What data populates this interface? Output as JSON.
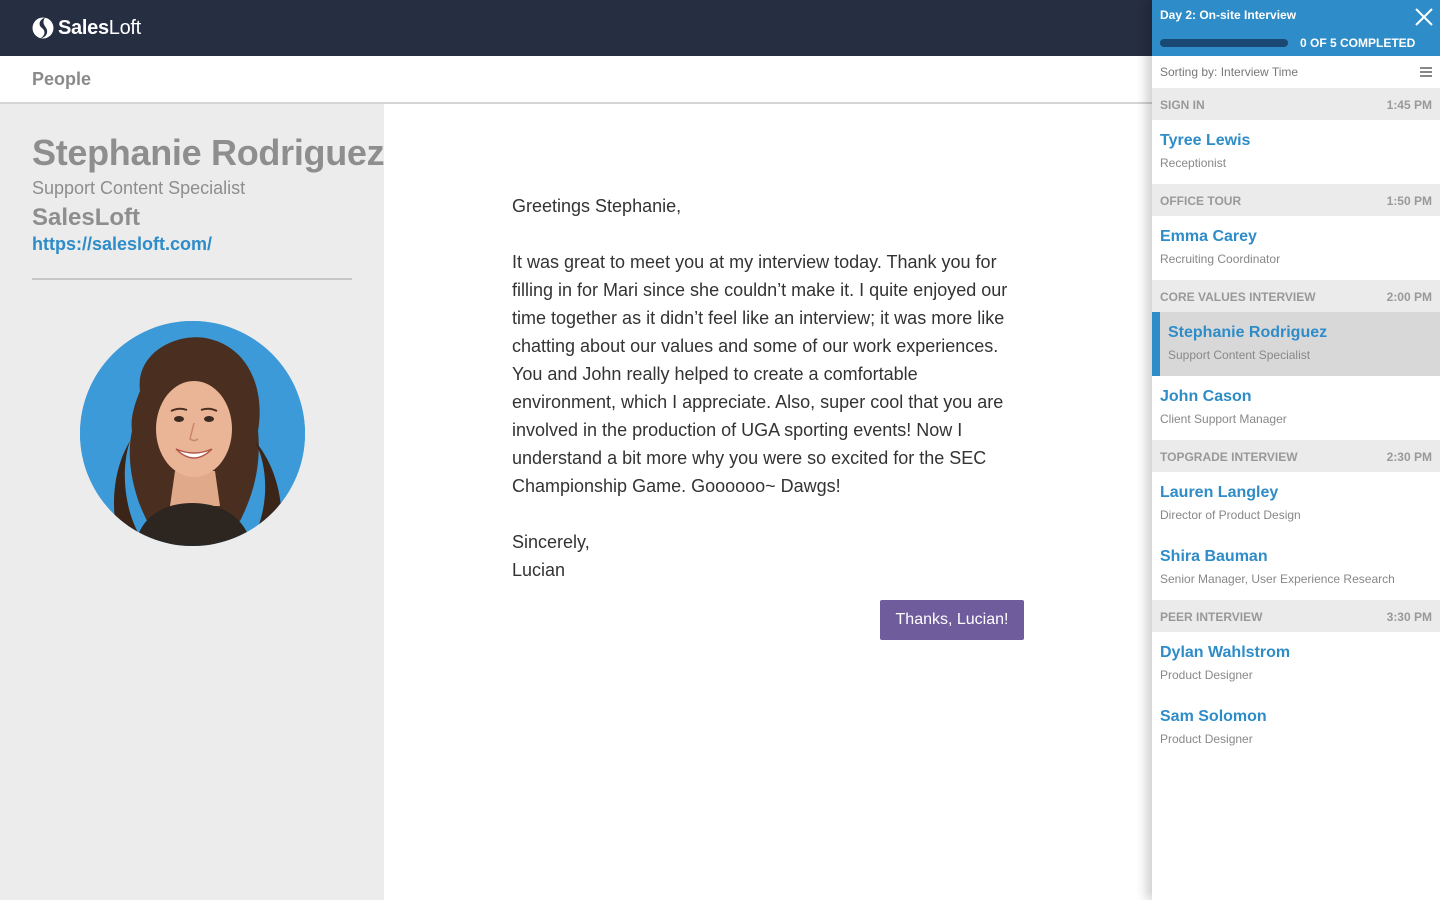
{
  "app": {
    "logo_bold": "Sales",
    "logo_light": "Loft"
  },
  "subheader": {
    "title": "People"
  },
  "profile": {
    "name": "Stephanie Rodriguez",
    "title": "Support Content Specialist",
    "company": "SalesLoft",
    "url": "https://salesloft.com/"
  },
  "letter": {
    "greeting": "Greetings Stephanie,",
    "body": "It was great to meet you at my interview today. Thank you for filling in for Mari since she couldn’t make it. I quite enjoyed our time together as it didn’t feel like an interview; it was more like chatting about our values and some of our work experiences. You and John really helped to create a comfortable environment, which I appreciate. Also, super cool that you are involved in the production of UGA sporting events! Now I understand a bit more why you were so excited for the SEC Championship Game. Goooooo~ Dawgs!",
    "closing": "Sincerely,",
    "signature": "Lucian",
    "button_label": "Thanks, Lucian!"
  },
  "panel": {
    "title": "Day 2: On-site Interview",
    "progress_text": "0 OF 5 COMPLETED",
    "progress_fraction": 0.0,
    "sort_text": "Sorting by: Interview Time",
    "sections": [
      {
        "title": "SIGN IN",
        "time": "1:45 PM",
        "people": [
          {
            "name": "Tyree Lewis",
            "role": "Receptionist"
          }
        ]
      },
      {
        "title": "OFFICE TOUR",
        "time": "1:50 PM",
        "people": [
          {
            "name": "Emma Carey",
            "role": "Recruiting Coordinator"
          }
        ]
      },
      {
        "title": "CORE VALUES INTERVIEW",
        "time": "2:00 PM",
        "people": [
          {
            "name": "Stephanie Rodriguez",
            "role": "Support Content Specialist"
          },
          {
            "name": "John Cason",
            "role": "Client Support Manager"
          }
        ]
      },
      {
        "title": "TOPGRADE INTERVIEW",
        "time": "2:30 PM",
        "people": [
          {
            "name": "Lauren Langley",
            "role": "Director of Product Design"
          },
          {
            "name": "Shira Bauman",
            "role": "Senior Manager, User Experience Research"
          }
        ]
      },
      {
        "title": "PEER INTERVIEW",
        "time": "3:30 PM",
        "people": [
          {
            "name": "Dylan Wahlstrom",
            "role": "Product Designer"
          },
          {
            "name": "Sam Solomon",
            "role": "Product Designer"
          }
        ]
      }
    ]
  },
  "colors": {
    "navbar": "#262e42",
    "accent": "#2e8cc8",
    "button": "#6f5c9c",
    "profile_bg": "#ececec"
  },
  "icons": {
    "logo": "salesloft-logo-icon",
    "close": "close-icon",
    "menu": "hamburger-menu-icon"
  }
}
